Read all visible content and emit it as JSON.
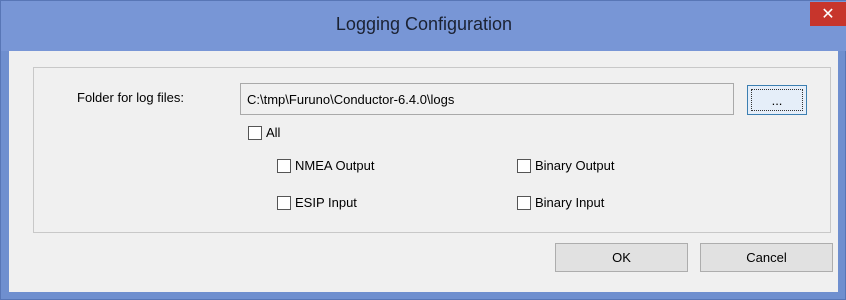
{
  "window": {
    "title": "Logging Configuration",
    "close_glyph": "✕"
  },
  "form": {
    "folder_label": "Folder for log files:",
    "folder_value": "C:\\tmp\\Furuno\\Conductor-6.4.0\\logs",
    "browse_label": "..."
  },
  "checkboxes": {
    "all": {
      "label": "All",
      "checked": false
    },
    "nmea_output": {
      "label": "NMEA Output",
      "checked": false
    },
    "binary_output": {
      "label": "Binary Output",
      "checked": false
    },
    "esip_input": {
      "label": "ESIP Input",
      "checked": false
    },
    "binary_input": {
      "label": "Binary Input",
      "checked": false
    }
  },
  "buttons": {
    "ok": "OK",
    "cancel": "Cancel"
  },
  "colors": {
    "title_bar": "#7896d6",
    "close_button": "#c7352c",
    "dialog_background": "#f0f0f0"
  },
  "icons": {
    "close": "close-icon"
  }
}
